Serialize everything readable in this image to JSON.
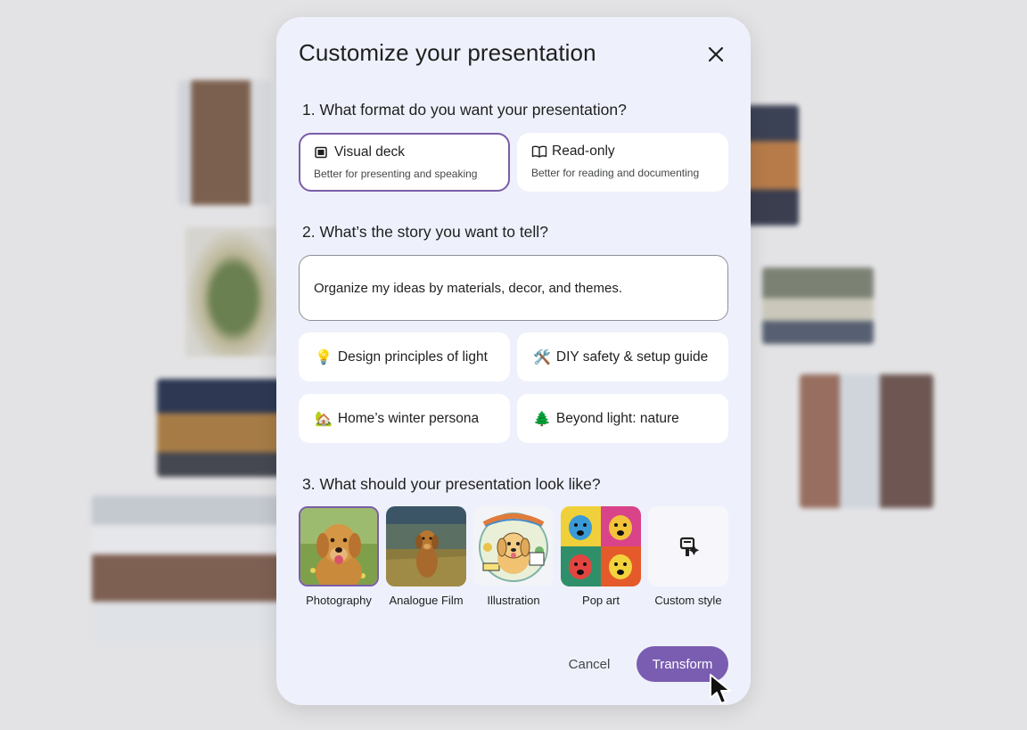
{
  "dialog": {
    "title": "Customize your presentation",
    "close_icon": "close-icon"
  },
  "format": {
    "question": "1. What format do you want your presentation?",
    "options": [
      {
        "label": "Visual deck",
        "description": "Better for presenting and speaking",
        "icon": "slides-icon",
        "selected": true
      },
      {
        "label": "Read-only",
        "description": "Better for reading and documenting",
        "icon": "book-icon",
        "selected": false
      }
    ]
  },
  "story": {
    "question": "2. What’s the story you want to tell?",
    "value": "Organize my ideas by materials, decor, and themes.",
    "suggestions": [
      {
        "emoji": "💡",
        "label": "Design principles of light"
      },
      {
        "emoji": "🛠️",
        "label": "DIY safety & setup guide"
      },
      {
        "emoji": "🏡",
        "label": "Home’s winter persona"
      },
      {
        "emoji": "🌲",
        "label": "Beyond light: nature"
      }
    ]
  },
  "look": {
    "question": "3. What should your presentation look like?",
    "styles": [
      {
        "label": "Photography",
        "selected": true
      },
      {
        "label": "Analogue Film",
        "selected": false
      },
      {
        "label": "Illustration",
        "selected": false
      },
      {
        "label": "Pop art",
        "selected": false
      },
      {
        "label": "Custom style",
        "icon": "custom-style-icon",
        "selected": false
      }
    ]
  },
  "actions": {
    "cancel": "Cancel",
    "transform": "Transform"
  },
  "colors": {
    "accent": "#7a5db1",
    "dialog_bg": "#eef1fb"
  }
}
